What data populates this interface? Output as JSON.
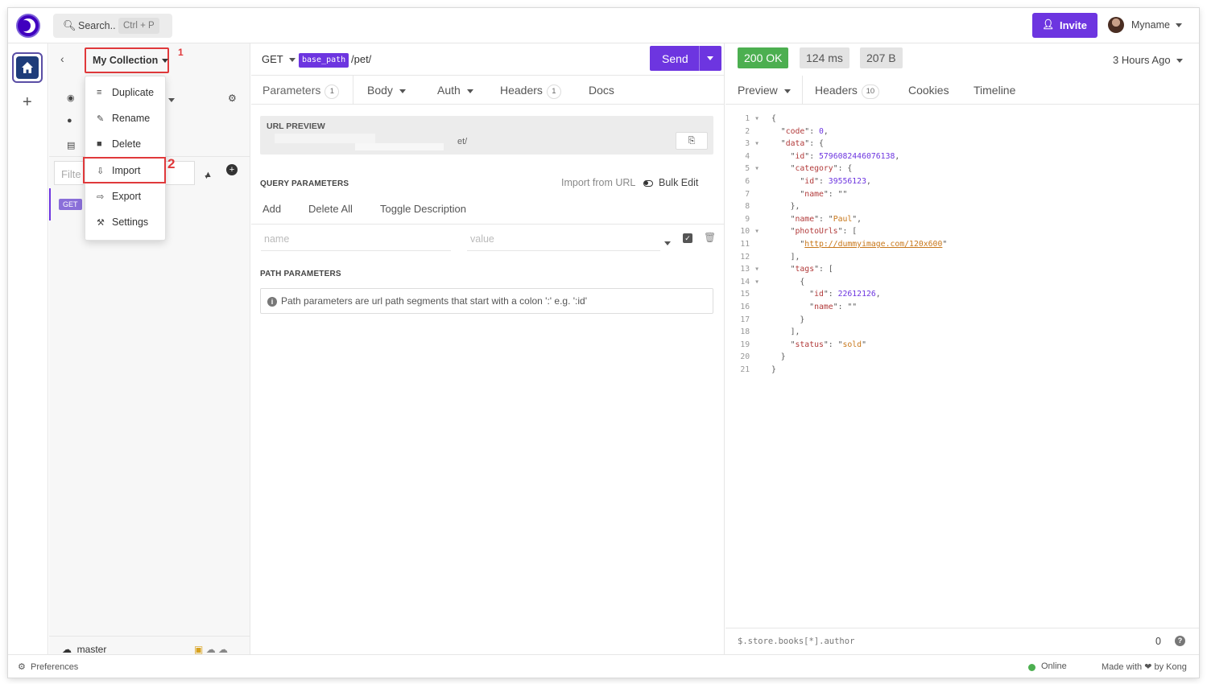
{
  "header": {
    "search_label": "Search..",
    "search_shortcut": "Ctrl + P",
    "invite_label": "Invite",
    "user_name": "Myname"
  },
  "sidebar": {
    "collection_name": "My Collection",
    "filter_placeholder": "Filte",
    "request_method": "GET",
    "branch_name": "master",
    "annotation_1": "1",
    "annotation_2": "2"
  },
  "collection_menu": {
    "items": [
      {
        "label": "Duplicate",
        "icon": "list-icon"
      },
      {
        "label": "Rename",
        "icon": "edit-icon"
      },
      {
        "label": "Delete",
        "icon": "trash-icon"
      },
      {
        "label": "Import",
        "icon": "import-icon"
      },
      {
        "label": "Export",
        "icon": "export-icon"
      },
      {
        "label": "Settings",
        "icon": "wrench-icon"
      }
    ]
  },
  "request": {
    "method": "GET",
    "base_path_tag": "base_path",
    "url_path": "/pet/",
    "send_label": "Send",
    "tabs": [
      {
        "label": "Parameters",
        "count": "1"
      },
      {
        "label": "Body"
      },
      {
        "label": "Auth"
      },
      {
        "label": "Headers",
        "count": "1"
      },
      {
        "label": "Docs"
      }
    ],
    "url_preview_title": "URL PREVIEW",
    "url_preview_value": "et/",
    "query_params_title": "QUERY PARAMETERS",
    "import_from_url": "Import from URL",
    "bulk_edit": "Bulk Edit",
    "actions": [
      "Add",
      "Delete All",
      "Toggle Description"
    ],
    "name_placeholder": "name",
    "value_placeholder": "value",
    "path_params_title": "PATH PARAMETERS",
    "path_params_info": "Path parameters are url path segments that start with a colon ':' e.g. ':id'"
  },
  "response": {
    "status": "200 OK",
    "time": "124 ms",
    "size": "207 B",
    "age": "3 Hours Ago",
    "tabs": [
      {
        "label": "Preview"
      },
      {
        "label": "Headers",
        "count": "10"
      },
      {
        "label": "Cookies"
      },
      {
        "label": "Timeline"
      }
    ],
    "body_lines": [
      "{",
      "  \"code\": 0,",
      "  \"data\": {",
      "    \"id\": 5796082446076138,",
      "    \"category\": {",
      "      \"id\": 39556123,",
      "      \"name\": \"\"",
      "    },",
      "    \"name\": \"Paul\",",
      "    \"photoUrls\": [",
      "      \"http://dummyimage.com/120x600\"",
      "    ],",
      "    \"tags\": [",
      "      {",
      "        \"id\": 22612126,",
      "        \"name\": \"\"",
      "      }",
      "    ],",
      "    \"status\": \"sold\"",
      "  }",
      "}"
    ],
    "filter_placeholder": "$.store.books[*].author",
    "filter_count": "0"
  },
  "footer": {
    "preferences": "Preferences",
    "online": "Online",
    "made_with": "Made with ❤ by Kong"
  },
  "colors": {
    "accent": "#6d35e0",
    "ok": "#4caf50",
    "highlight_annotation": "#e0393b"
  }
}
